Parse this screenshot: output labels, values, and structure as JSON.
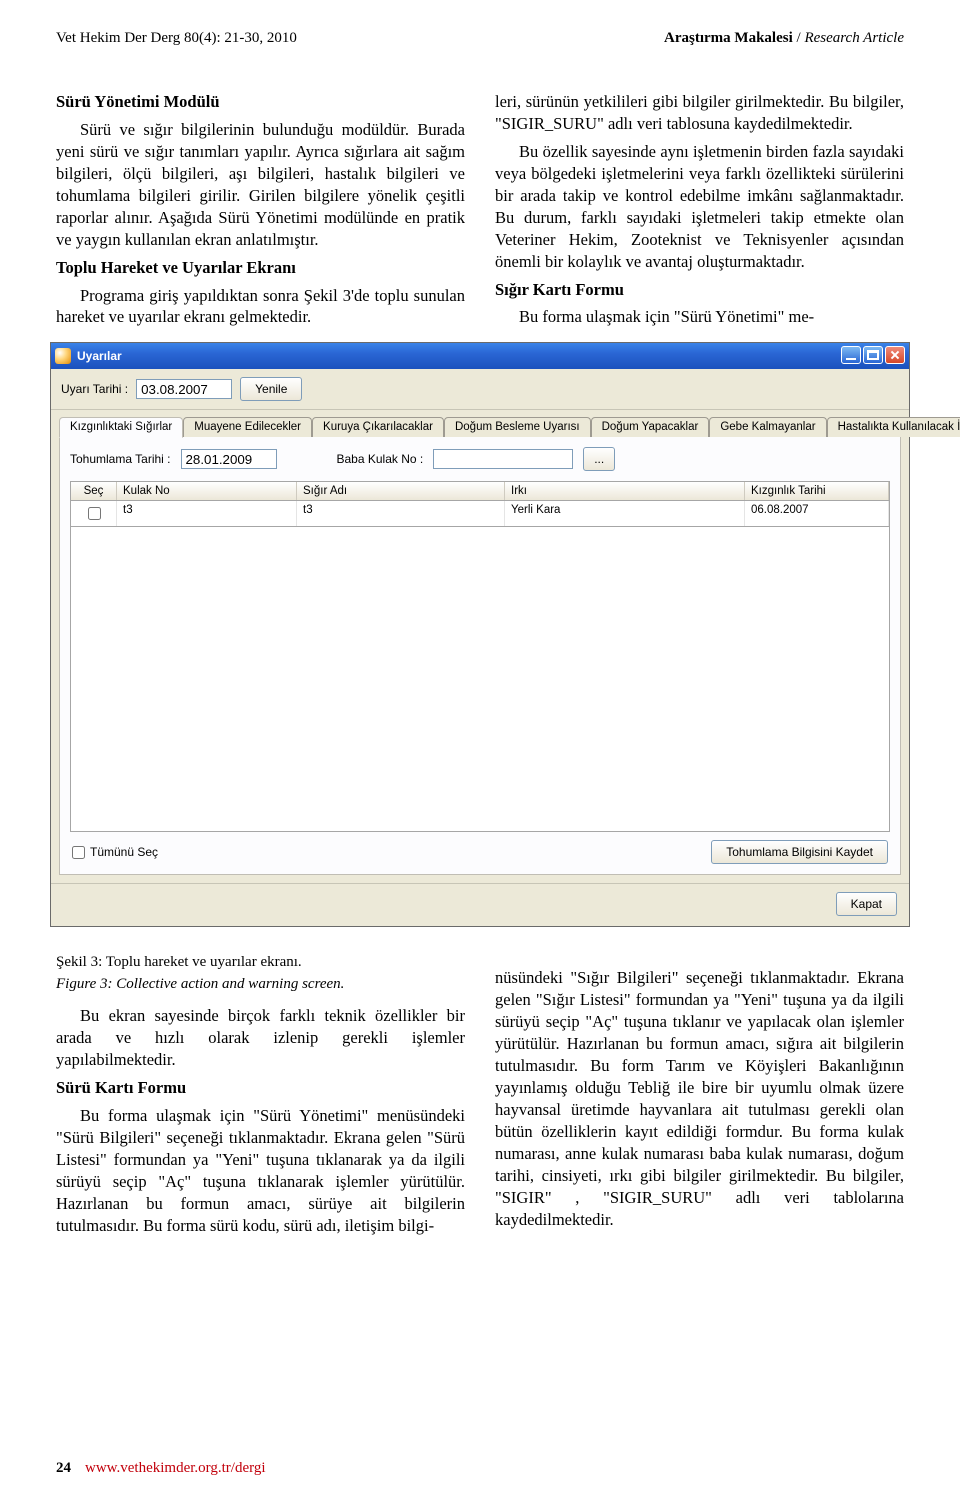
{
  "header": {
    "left": "Vet Hekim Der Derg 80(4): 21-30, 2010",
    "right_tr": "Araştırma Makalesi",
    "right_sep": " / ",
    "right_en": "Research Article"
  },
  "section_title": "Sürü Yönetimi Modülü",
  "left_col": {
    "p1": "Sürü ve sığır bilgilerinin bulunduğu modüldür. Burada yeni sürü ve sığır tanımları yapılır. Ayrıca sığırlara ait sağım bilgileri, ölçü bilgileri, aşı bilgileri, hastalık bilgileri ve tohumlama bilgileri girilir. Girilen bilgilere yönelik çeşitli raporlar alınır. Aşağıda Sürü Yönetimi modülünde en pratik ve yaygın kullanılan ekran anlatılmıştır.",
    "h3": "Toplu Hareket ve Uyarılar Ekranı",
    "p2": "Programa giriş yapıldıktan sonra Şekil 3'de toplu sunulan hareket ve uyarılar ekranı gelmektedir."
  },
  "right_col": {
    "p1": "leri, sürünün yetkilileri gibi bilgiler girilmektedir. Bu bilgiler, \"SIGIR_SURU\" adlı veri tablosuna kaydedilmektedir.",
    "p2": "Bu özellik sayesinde aynı işletmenin birden fazla sayıdaki veya bölgedeki işletmelerini veya farklı özellikteki sürülerini bir arada takip ve kontrol edebilme imkânı sağlanmaktadır. Bu durum, farklı sayıdaki işletmeleri takip etmekte olan Veteriner Hekim, Zooteknist ve Teknisyenler açısından önemli bir kolaylık ve avantaj oluşturmaktadır.",
    "h3": "Sığır Kartı Formu",
    "p3": "Bu forma ulaşmak için \"Sürü Yönetimi\" me-"
  },
  "screenshot": {
    "window_title": "Uyarılar",
    "toolbar": {
      "date_label": "Uyarı Tarihi :",
      "date_value": "03.08.2007",
      "refresh": "Yenile"
    },
    "tabs": [
      "Kızgınlıktaki Sığırlar",
      "Muayene Edilecekler",
      "Kuruya Çıkarılacaklar",
      "Doğum Besleme Uyarısı",
      "Doğum Yapacaklar",
      "Gebe Kalmayanlar",
      "Hastalıkta Kullanılacak İlaçlar"
    ],
    "filter": {
      "toh_label": "Tohumlama Tarihi :",
      "toh_value": "28.01.2009",
      "baba_label": "Baba Kulak No :",
      "baba_value": "",
      "lookup": "..."
    },
    "columns": [
      "Seç",
      "Kulak No",
      "Sığır Adı",
      "Irkı",
      "Kızgınlık Tarihi"
    ],
    "row": {
      "kulak": "t3",
      "ad": "t3",
      "irk": "Yerli Kara",
      "tarih": "06.08.2007"
    },
    "select_all": "Tümünü Seç",
    "save_btn": "Tohumlama Bilgisini Kaydet",
    "close_btn": "Kapat"
  },
  "caption_tr": "Şekil 3: Toplu hareket ve uyarılar ekranı.",
  "caption_en": "Figure 3: Collective action and warning screen.",
  "lower_left": {
    "p1": "Bu ekran sayesinde birçok farklı teknik özellikler bir arada ve hızlı olarak izlenip gerekli işlemler yapılabilmektedir.",
    "h3": "Sürü Kartı Formu",
    "p2": "Bu forma ulaşmak için \"Sürü Yönetimi\" menüsündeki \"Sürü Bilgileri\" seçeneği tıklanmaktadır. Ekrana gelen \"Sürü Listesi\" formundan ya \"Yeni\" tuşuna tıklanarak ya da ilgili sürüyü seçip \"Aç\" tuşuna tıklanarak işlemler yürütülür. Hazırlanan bu formun amacı, sürüye ait bilgilerin tutulmasıdır. Bu forma sürü kodu, sürü adı, iletişim bilgi-"
  },
  "lower_right": {
    "p1": "nüsündeki \"Sığır Bilgileri\" seçeneği tıklanmaktadır. Ekrana gelen \"Sığır Listesi\" formundan ya \"Yeni\" tuşuna ya da ilgili sürüyü seçip \"Aç\" tuşuna tıklanır ve yapılacak olan işlemler yürütülür. Hazırlanan bu formun amacı, sığıra ait bilgilerin tutulmasıdır. Bu form Tarım ve Köyişleri Bakanlığının yayınlamış olduğu Tebliğ ile bire bir uyumlu olmak üzere hayvansal üretimde hayvanlara ait tutulması gerekli olan bütün özelliklerin kayıt edildiği formdur. Bu forma kulak numarası, anne kulak numarası baba kulak numarası, doğum tarihi, cinsiyeti, ırkı gibi bilgiler girilmektedir. Bu bilgiler, \"SIGIR\" , \"SIGIR_SURU\" adlı veri tablolarına kaydedilmektedir."
  },
  "footer": {
    "page": "24",
    "url": "www.vethekimder.org.tr/dergi"
  }
}
